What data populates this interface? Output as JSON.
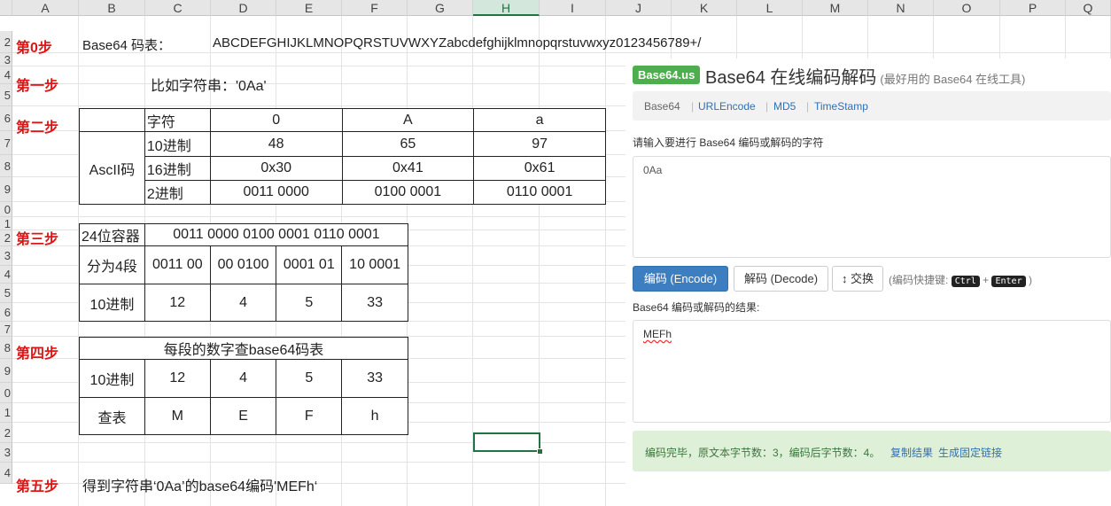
{
  "columns": [
    "A",
    "B",
    "C",
    "D",
    "E",
    "F",
    "G",
    "H",
    "I",
    "J",
    "K",
    "L",
    "M",
    "N",
    "O",
    "P",
    "Q"
  ],
  "rows": [
    "2",
    "3",
    "4",
    "5",
    "6",
    "7",
    "8",
    "9",
    "0",
    "1",
    "2",
    "3",
    "4",
    "5",
    "6",
    "7",
    "8",
    "9",
    "0",
    "1",
    "2",
    "3",
    "4"
  ],
  "selected_column": "H",
  "steps": {
    "s0": "第0步",
    "s1": "第一步",
    "s2": "第二步",
    "s3": "第三步",
    "s4": "第四步",
    "s5": "第五步"
  },
  "row0": {
    "label": "Base64 码表：",
    "alphabet": "ABCDEFGHIJKLMNOPQRSTUVWXYZabcdefghijklmnopqrstuvwxyz0123456789+/"
  },
  "row1": {
    "text": "比如字符串：'0Aa'"
  },
  "ascii_table": {
    "group_label": "AscII码",
    "header": [
      "字符",
      "0",
      "A",
      "a"
    ],
    "rows": [
      [
        "10进制",
        "48",
        "65",
        "97"
      ],
      [
        "16进制",
        "0x30",
        "0x41",
        "0x61"
      ],
      [
        "2进制",
        "0011 0000",
        "0100 0001",
        "0110 0001"
      ]
    ]
  },
  "bits_table": {
    "r1": [
      "24位容器",
      "0011 0000 0100 0001 0110 0001"
    ],
    "r2": [
      "分为4段",
      "0011 00",
      "00 0100",
      "0001 01",
      "10 0001"
    ],
    "r3": [
      "10进制",
      "12",
      "4",
      "5",
      "33"
    ]
  },
  "lookup_table": {
    "title": "每段的数字查base64码表",
    "r1": [
      "10进制",
      "12",
      "4",
      "5",
      "33"
    ],
    "r2": [
      "查表",
      "M",
      "E",
      "F",
      "h"
    ]
  },
  "row5": {
    "text": "得到字符串‘0Aa’的base64编码'MEFh‘"
  },
  "web": {
    "brand": "Base64.us",
    "title": "Base64 在线编码解码",
    "subtitle": "(最好用的 Base64 在线工具)",
    "nav": [
      "Base64",
      "URLEncode",
      "MD5",
      "TimeStamp"
    ],
    "nav_sep": "|",
    "input_label": "请输入要进行 Base64 编码或解码的字符",
    "input_value": "0Aa",
    "encode_btn": "编码 (Encode)",
    "decode_btn": "解码 (Decode)",
    "swap_btn": "↕ 交换",
    "shortcut_prefix": "(编码快捷键:",
    "kbd1": "Ctrl",
    "plus": "+",
    "kbd2": "Enter",
    "shortcut_suffix": ")",
    "result_label": "Base64 编码或解码的结果:",
    "result_value": "MEFh",
    "status": "编码完毕，原文本字节数：3，编码后字节数：4。",
    "copy_link": "复制结果",
    "fixed_link": "生成固定链接"
  }
}
